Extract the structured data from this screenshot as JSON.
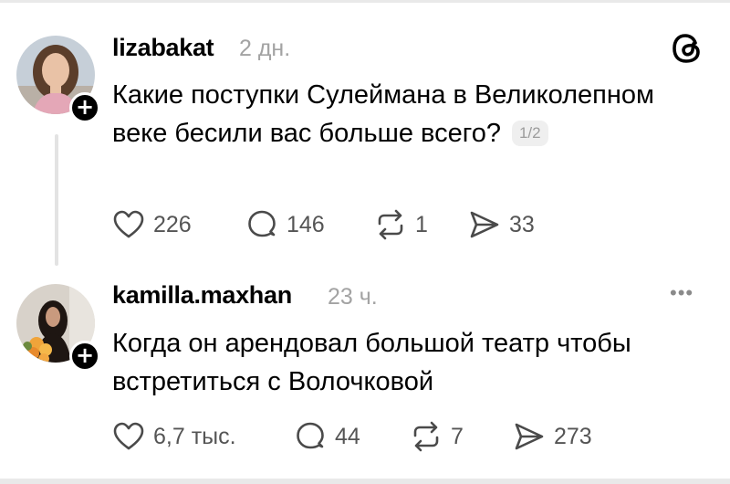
{
  "posts": [
    {
      "username": "lizabakat",
      "timestamp": "2 дн.",
      "text": "Какие поступки Сулеймана в Великолепном веке бесили вас больше всего?",
      "page_indicator": "1/2",
      "actions": {
        "likes": "226",
        "replies": "146",
        "reposts": "1",
        "shares": "33"
      },
      "icons": [
        "heart-icon",
        "comment-icon",
        "repost-icon",
        "share-icon",
        "threads-logo-icon",
        "follow-plus-icon"
      ]
    },
    {
      "username": "kamilla.maxhan",
      "timestamp": "23 ч.",
      "text_lines": [
        "Когда он арендовал большой театр чтобы",
        "встретиться с Волочковой"
      ],
      "more_label": "•••",
      "actions": {
        "likes": "6,7 тыс.",
        "replies": "44",
        "reposts": "7",
        "shares": "273"
      },
      "icons": [
        "heart-icon",
        "comment-icon",
        "repost-icon",
        "share-icon",
        "more-options-icon",
        "follow-plus-icon"
      ]
    }
  ],
  "colors": {
    "text": "#000000",
    "muted": "#a3a3a3",
    "icon": "#4a4a4a",
    "divider": "#e9e9e9"
  }
}
